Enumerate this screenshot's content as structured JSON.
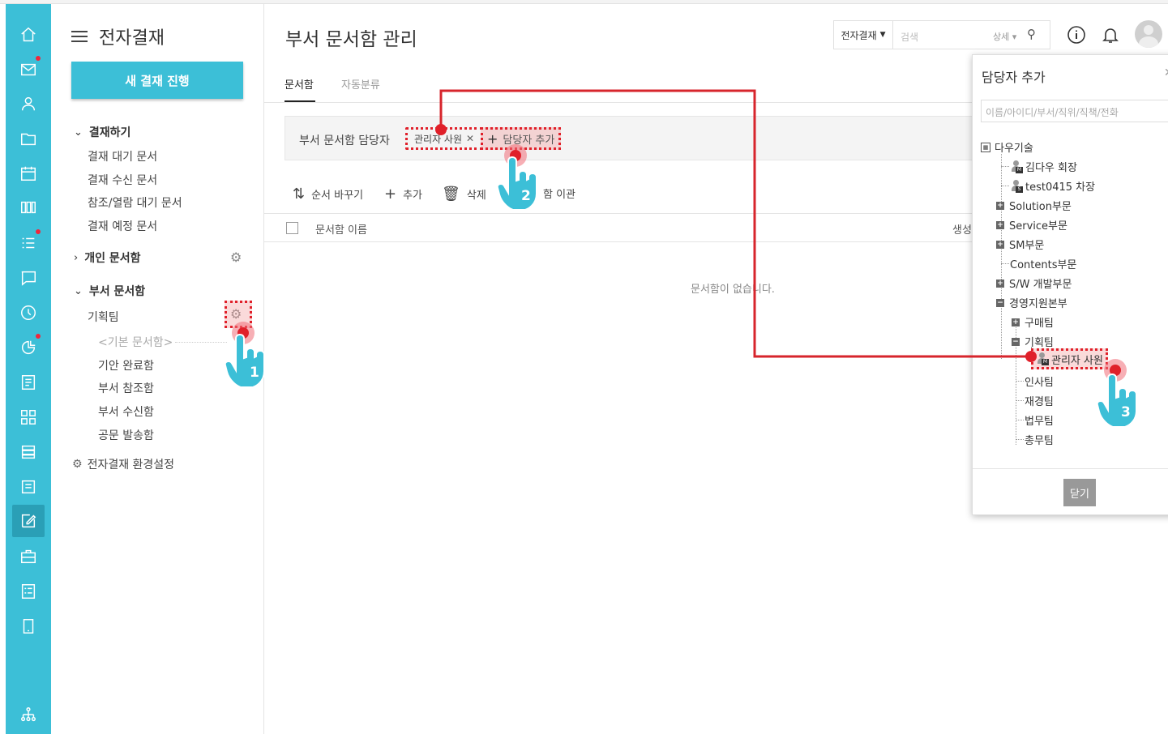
{
  "sidebar": {
    "title": "전자결재",
    "new_button": "새 결재 진행",
    "sections": [
      {
        "label": "결재하기",
        "items": [
          "결재 대기 문서",
          "결재 수신 문서",
          "참조/열람 대기 문서",
          "결재 예정 문서"
        ]
      },
      {
        "label": "개인 문서함"
      },
      {
        "label": "부서 문서함",
        "team": "기획팀",
        "items": [
          "<기본 문서함>",
          "기안 완료함",
          "부서 참조함",
          "부서 수신함",
          "공문 발송함"
        ]
      }
    ],
    "settings": "전자결재 환경설정"
  },
  "header": {
    "title": "부서 문서함 관리",
    "search_scope": "전자결재",
    "search_placeholder": "검색",
    "search_detail": "상세"
  },
  "tabs": [
    "문서함",
    "자동분류"
  ],
  "manager": {
    "label": "부서 문서함 담당자",
    "chip": "관리자 사원",
    "add": "담당자 추가"
  },
  "toolbar": {
    "reorder": "순서 바꾸기",
    "add": "추가",
    "delete": "삭제",
    "transfer": "함 이관"
  },
  "table": {
    "col_name": "문서함 이름",
    "col_created": "생성",
    "empty": "문서함이 없습니다."
  },
  "popup": {
    "title": "담당자 추가",
    "search_placeholder": "이름/아이디/부서/직위/직책/전화",
    "root": "다우기술",
    "nodes": [
      "김다우 회장",
      "test0415 차장",
      "Solution부문",
      "Service부문",
      "SM부문",
      "Contents부문",
      "S/W 개발부문",
      "경영지원본부",
      "구매팀",
      "기획팀",
      "관리자 사원",
      "인사팀",
      "재경팀",
      "법무팀",
      "총무팀"
    ],
    "close": "닫기"
  },
  "steps": [
    "1",
    "2",
    "3"
  ],
  "colors": {
    "accent": "#3cbfd7",
    "highlight": "#e0202a"
  }
}
